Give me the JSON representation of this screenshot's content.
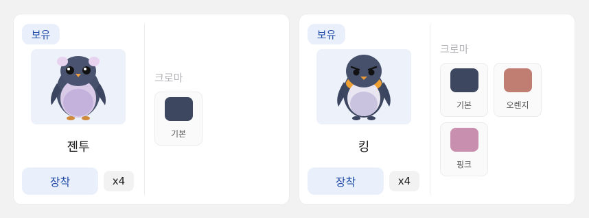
{
  "cards": [
    {
      "owned_label": "보유",
      "name": "젠투",
      "equip_label": "장착",
      "count": "x4",
      "chroma_title": "크로마",
      "chromas": [
        {
          "label": "기본",
          "color": "#3d4760"
        }
      ],
      "character_icon": "gentoo-penguin-icon"
    },
    {
      "owned_label": "보유",
      "name": "킹",
      "equip_label": "장착",
      "count": "x4",
      "chroma_title": "크로마",
      "chromas": [
        {
          "label": "기본",
          "color": "#3d4760"
        },
        {
          "label": "오렌지",
          "color": "#c07d72"
        },
        {
          "label": "핑크",
          "color": "#c98fae"
        }
      ],
      "character_icon": "king-penguin-icon"
    }
  ],
  "colors": {
    "accent": "#1f4aa6",
    "accent_bg": "#eaf0fb",
    "muted_text": "#b4b4b8"
  }
}
